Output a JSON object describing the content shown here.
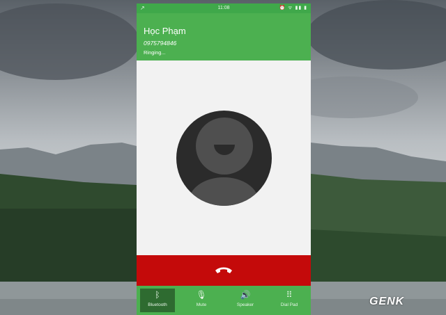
{
  "status_bar": {
    "time": "11:08",
    "left_icon": "missed-call-icon",
    "right_icons": "⏰ ᯤ ▮▮ ▮"
  },
  "call": {
    "contact_name": "Học Phạm",
    "phone_number": "0975794846",
    "status": "Ringing..."
  },
  "actions": [
    {
      "label": "Bluetooth",
      "icon": "bluetooth-icon",
      "active": true
    },
    {
      "label": "Mute",
      "icon": "microphone-icon",
      "active": false
    },
    {
      "label": "Speaker",
      "icon": "speaker-icon",
      "active": false
    },
    {
      "label": "Dial Pad",
      "icon": "dialpad-icon",
      "active": false
    }
  ],
  "colors": {
    "header_green": "#4cb050",
    "end_call_red": "#c40a0a",
    "avatar_dark": "#2b2b2b"
  },
  "watermark": "GENK"
}
